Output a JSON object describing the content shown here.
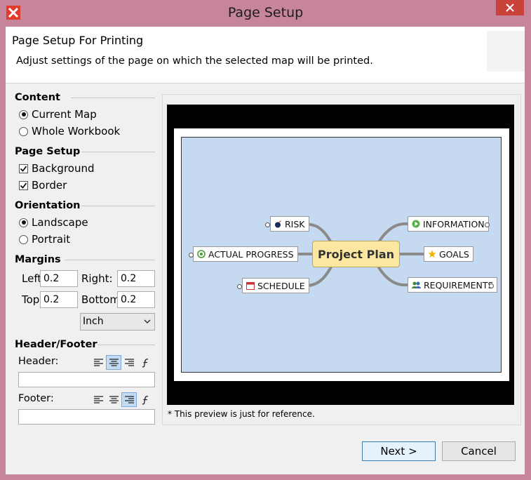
{
  "window": {
    "title": "Page Setup"
  },
  "header": {
    "title": "Page Setup For Printing",
    "description": "Adjust settings of the page on which the selected map will be printed."
  },
  "content": {
    "label": "Content",
    "options": [
      {
        "label": "Current Map",
        "checked": true
      },
      {
        "label": "Whole Workbook",
        "checked": false
      }
    ]
  },
  "page_setup": {
    "label": "Page Setup",
    "options": [
      {
        "label": "Background",
        "checked": true
      },
      {
        "label": "Border",
        "checked": true
      }
    ]
  },
  "orientation": {
    "label": "Orientation",
    "options": [
      {
        "label": "Landscape",
        "checked": true
      },
      {
        "label": "Portrait",
        "checked": false
      }
    ]
  },
  "margins": {
    "label": "Margins",
    "left_label": "Left:",
    "left_value": "0.2",
    "right_label": "Right:",
    "right_value": "0.2",
    "top_label": "Top:",
    "top_value": "0.2",
    "bottom_label": "Bottom:",
    "bottom_value": "0.2",
    "unit": "Inch"
  },
  "header_footer": {
    "label": "Header/Footer",
    "header_label": "Header:",
    "header_value": "",
    "header_align": "center",
    "footer_label": "Footer:",
    "footer_value": "",
    "footer_align": "right"
  },
  "preview": {
    "central": "Project Plan",
    "topics": {
      "risk": "RISK",
      "actual_progress": "ACTUAL PROGRESS",
      "schedule": "SCHEDULE",
      "information": "INFORMATION",
      "goals": "GOALS",
      "requirements": "REQUIREMENTS"
    },
    "note": "* This preview is just for reference."
  },
  "buttons": {
    "next": "Next >",
    "cancel": "Cancel"
  },
  "colors": {
    "titlebar": "#c7859c",
    "close": "#c9413b",
    "map_bg": "#c5d9f1",
    "central": "#fbe7a0"
  }
}
